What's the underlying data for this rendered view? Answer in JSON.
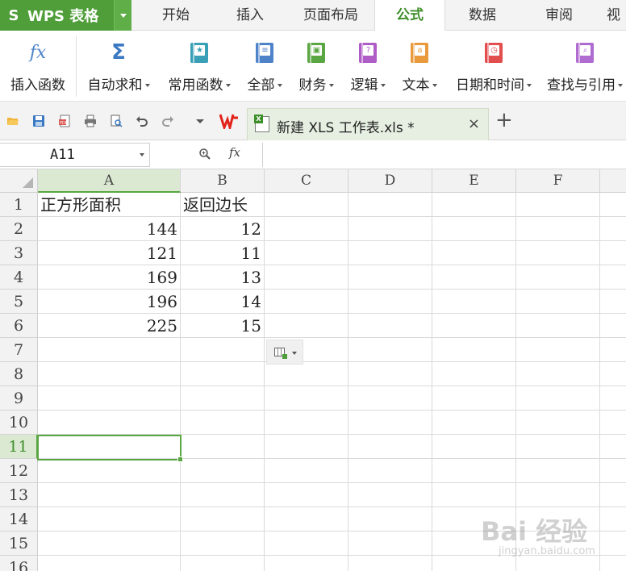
{
  "app": {
    "logo": "S",
    "name": "WPS 表格"
  },
  "menu_tabs": [
    {
      "label": "开始"
    },
    {
      "label": "插入"
    },
    {
      "label": "页面布局"
    },
    {
      "label": "公式"
    },
    {
      "label": "数据"
    },
    {
      "label": "审阅"
    },
    {
      "label": "视"
    }
  ],
  "active_menu_tab": "公式",
  "ribbon": {
    "insert_function": {
      "icon": "fx-icon",
      "symbol": "fx",
      "label": "插入函数"
    },
    "autosum": {
      "icon": "sigma-icon",
      "symbol": "Σ",
      "label": "自动求和"
    },
    "groups": [
      {
        "icon": "star-book-icon",
        "glyph": "★",
        "label": "常用函数",
        "color": "#3aa0b8"
      },
      {
        "icon": "list-book-icon",
        "glyph": "≡",
        "label": "全部",
        "color": "#4f83c9"
      },
      {
        "icon": "finance-book-icon",
        "glyph": "▣",
        "label": "财务",
        "color": "#5aa642"
      },
      {
        "icon": "logic-book-icon",
        "glyph": "?",
        "label": "逻辑",
        "color": "#b05cc6"
      },
      {
        "icon": "text-book-icon",
        "glyph": "a",
        "label": "文本",
        "color": "#e89a3c"
      },
      {
        "icon": "clock-book-icon",
        "glyph": "◷",
        "label": "日期和时间",
        "color": "#e24d4d"
      },
      {
        "icon": "search-book-icon",
        "glyph": "⌕",
        "label": "查找与引用",
        "color": "#b06bd0"
      }
    ]
  },
  "document_tab": {
    "title": "新建 XLS 工作表.xls *",
    "close": "×",
    "new_tab": "+"
  },
  "formula_bar": {
    "cell_name": "A11",
    "fx_label": "fx",
    "formula": ""
  },
  "columns": [
    "A",
    "B",
    "C",
    "D",
    "E",
    "F"
  ],
  "rows": [
    "1",
    "2",
    "3",
    "4",
    "5",
    "6",
    "7",
    "8",
    "9",
    "10",
    "11",
    "12",
    "13",
    "14",
    "15",
    "16"
  ],
  "selected_cell": "A11",
  "cells": {
    "A1": "正方形面积",
    "B1": "返回边长",
    "A2": "144",
    "B2": "12",
    "A3": "121",
    "B3": "11",
    "A4": "169",
    "B4": "13",
    "A5": "196",
    "B5": "14",
    "A6": "225",
    "B6": "15"
  },
  "watermark": {
    "main": "Bai 经验",
    "sub": "jingyan.baidu.com"
  },
  "colors": {
    "accent": "#4f9e3a",
    "selection": "#5aa642",
    "header_selected": "#dbe9d3"
  }
}
